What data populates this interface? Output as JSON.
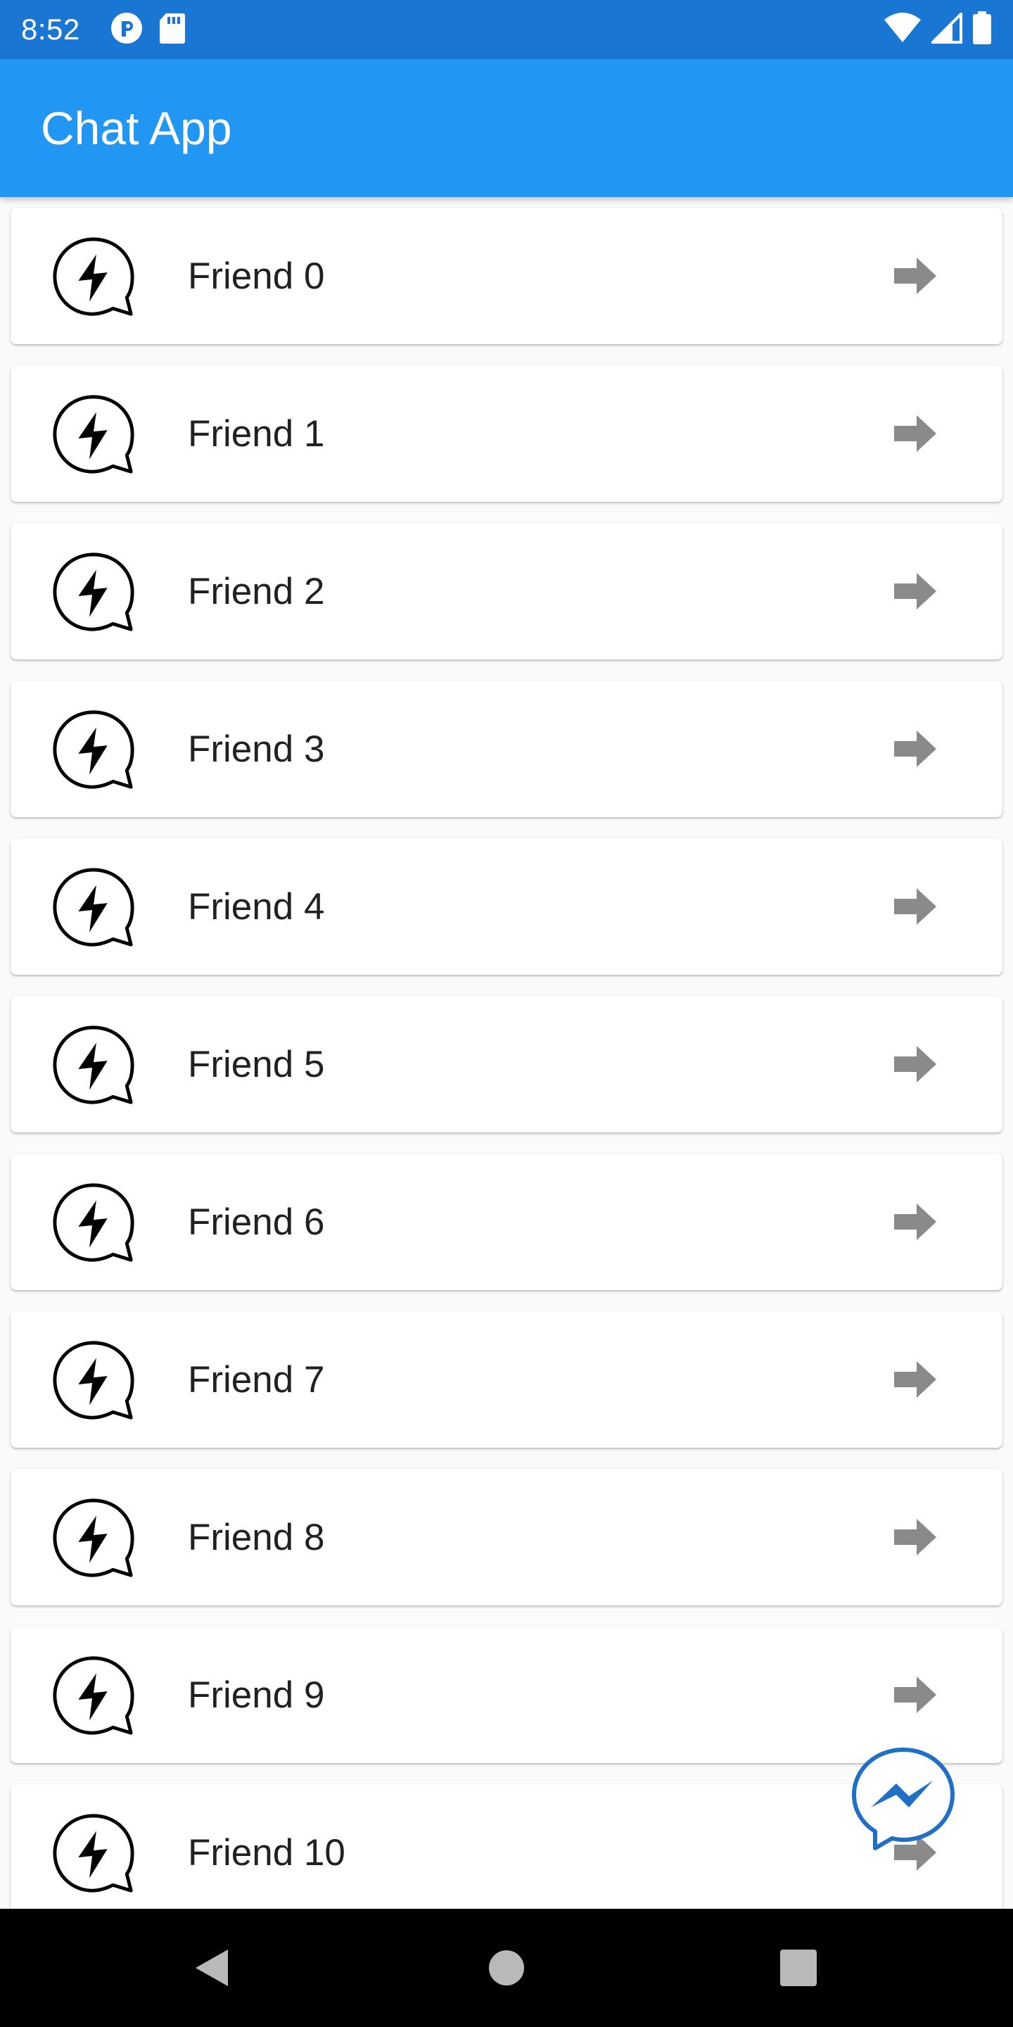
{
  "status_bar": {
    "time": "8:52",
    "icons_left": [
      "app-notification-icon",
      "sd-card-icon"
    ],
    "icons_right": [
      "wifi-icon",
      "cellular-signal-icon",
      "battery-icon"
    ]
  },
  "app_bar": {
    "title": "Chat App"
  },
  "friends": [
    {
      "name": "Friend 0"
    },
    {
      "name": "Friend 1"
    },
    {
      "name": "Friend 2"
    },
    {
      "name": "Friend 3"
    },
    {
      "name": "Friend 4"
    },
    {
      "name": "Friend 5"
    },
    {
      "name": "Friend 6"
    },
    {
      "name": "Friend 7"
    },
    {
      "name": "Friend 8"
    },
    {
      "name": "Friend 9"
    },
    {
      "name": "Friend 10"
    }
  ],
  "icons": {
    "list_leading": "messenger-outline-icon",
    "list_trailing": "arrow-right-icon",
    "fab": "messenger-icon"
  },
  "colors": {
    "status_bar": "#1976d2",
    "app_bar": "#2196f3",
    "fab": "#1e6fc5",
    "arrow": "#8a8a8a"
  }
}
